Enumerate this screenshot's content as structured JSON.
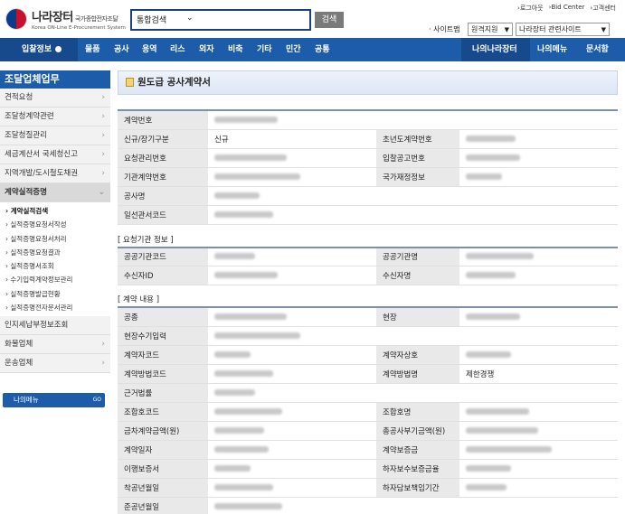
{
  "header": {
    "logo_title": "나라장터",
    "logo_title_small": "국가종합전자조달",
    "logo_sub": "Korea ON-Line E-Procurement System",
    "search_type": "통합검색",
    "search_button": "검색",
    "top_links": [
      "로그아웃",
      "Bid Center",
      "고객센터"
    ],
    "sitemap": "사이트맵",
    "remote_support": "원격지원",
    "related_sites": "나라장터 관련사이트"
  },
  "nav": {
    "home": "입찰정보",
    "items": [
      "물품",
      "공사",
      "용역",
      "리스",
      "외자",
      "비축",
      "기타",
      "민간",
      "공통"
    ],
    "right": [
      "나의나라장터",
      "나의메뉴",
      "문서함"
    ]
  },
  "sidebar": {
    "title": "조달업체업무",
    "items_top": [
      "견적요청",
      "조달청계약관련",
      "조달청질관리",
      "세금계산서 국세청신고",
      "지역개발/도시철도채권"
    ],
    "active_item": "계약실적증명",
    "sub_items": [
      "계약실적검색",
      "실적증명요청서작성",
      "실적증명요청서처리",
      "실적증명요청결과",
      "실적증명서조회",
      "수기입력계약정보관리",
      "실적증명발급현황",
      "실적증명전자문서관리"
    ],
    "items_bottom": [
      "인지세납부정보조회",
      "화물업체",
      "운송업체"
    ],
    "my_menu": "나의메뉴",
    "my_menu_go": "GO"
  },
  "main": {
    "title": "원도급 공사계약서",
    "section1_rows": [
      {
        "l1": "계약번호",
        "v1": "",
        "l2": "",
        "v2": ""
      },
      {
        "l1": "신규/장기구분",
        "v1": "신규",
        "l2": "초년도계약번호",
        "v2": ""
      },
      {
        "l1": "요청관리번호",
        "v1": "",
        "l2": "입찰공고번호",
        "v2": ""
      },
      {
        "l1": "기관계약번호",
        "v1": "",
        "l2": "국가재정정보",
        "v2": ""
      },
      {
        "l1": "공사명",
        "v1": "",
        "l2": "",
        "v2": ""
      },
      {
        "l1": "일선관서코드",
        "v1": "",
        "l2": "",
        "v2": ""
      }
    ],
    "section2_title": "[ 요청기관 정보 ]",
    "section2_rows": [
      {
        "l1": "공공기관코드",
        "v1": "",
        "l2": "공공기관명",
        "v2": ""
      },
      {
        "l1": "수신자ID",
        "v1": "",
        "l2": "수신자명",
        "v2": ""
      }
    ],
    "section3_title": "[ 계약 내용 ]",
    "section3_rows": [
      {
        "l1": "공종",
        "v1": "",
        "l2": "현장",
        "v2": ""
      },
      {
        "l1": "현장수기입력",
        "v1": "",
        "l2": "",
        "v2": ""
      },
      {
        "l1": "계약자코드",
        "v1": "",
        "l2": "계약자상호",
        "v2": ""
      },
      {
        "l1": "계약방법코드",
        "v1": "",
        "l2": "계약방법명",
        "v2": "제한경쟁"
      },
      {
        "l1": "근거법률",
        "v1": "",
        "l2": "",
        "v2": ""
      },
      {
        "l1": "조합호코드",
        "v1": "",
        "l2": "조합호명",
        "v2": ""
      },
      {
        "l1": "금차계약금액(원)",
        "v1": "",
        "l2": "총공사부기금액(원)",
        "v2": ""
      },
      {
        "l1": "계약일자",
        "v1": "",
        "l2": "계약보증금",
        "v2": ""
      },
      {
        "l1": "이행보증서",
        "v1": "",
        "l2": "하자보수보증금율",
        "v2": ""
      },
      {
        "l1": "착공년월일",
        "v1": "",
        "l2": "하자담보책임기간",
        "v2": ""
      },
      {
        "l1": "준공년월일",
        "v1": "",
        "l2": "",
        "v2": ""
      }
    ]
  }
}
